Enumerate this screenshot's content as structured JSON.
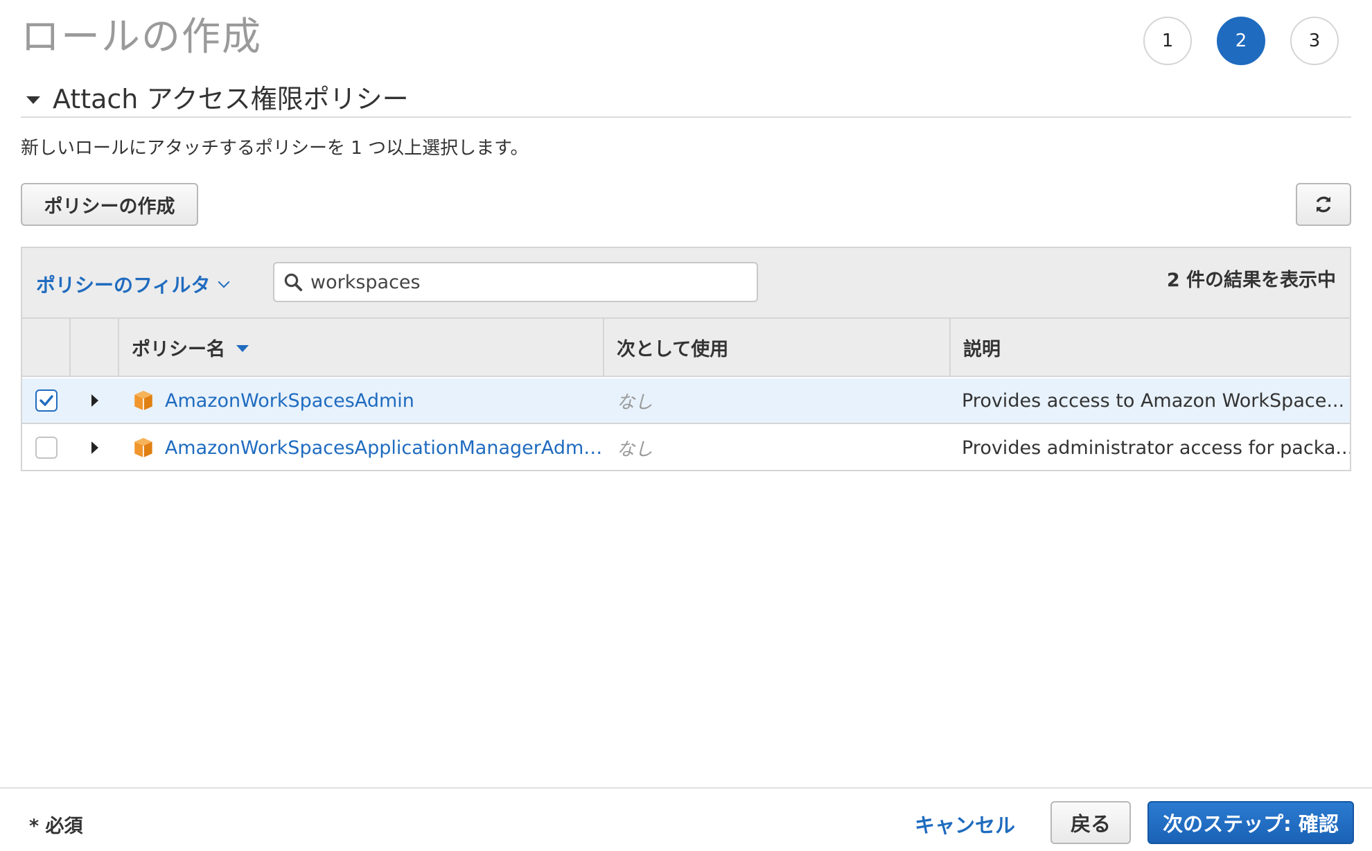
{
  "page": {
    "title": "ロールの作成",
    "steps": [
      "1",
      "2",
      "3"
    ],
    "active_step": 2
  },
  "section": {
    "title": "Attach アクセス権限ポリシー",
    "description": "新しいロールにアタッチするポリシーを 1 つ以上選択します。"
  },
  "toolbar": {
    "create_policy_label": "ポリシーの作成",
    "refresh_icon": "refresh-icon"
  },
  "filter": {
    "label": "ポリシーのフィルタ",
    "search_value": "workspaces",
    "results_text": "2 件の結果を表示中"
  },
  "table": {
    "columns": [
      "ポリシー名",
      "次として使用",
      "説明"
    ],
    "rows": [
      {
        "checked": true,
        "name": "AmazonWorkSpacesAdmin",
        "used_as": "なし",
        "description": "Provides access to Amazon WorkSpace..."
      },
      {
        "checked": false,
        "name": "AmazonWorkSpacesApplicationManagerAdmi...",
        "used_as": "なし",
        "description": "Provides administrator access for packa..."
      }
    ]
  },
  "footer": {
    "required_label": "* 必須",
    "cancel_label": "キャンセル",
    "back_label": "戻る",
    "next_label": "次のステップ: 確認"
  },
  "colors": {
    "accent": "#1f6bbf",
    "selected_row": "#e8f2fc",
    "policy_icon": "#f0962c"
  }
}
